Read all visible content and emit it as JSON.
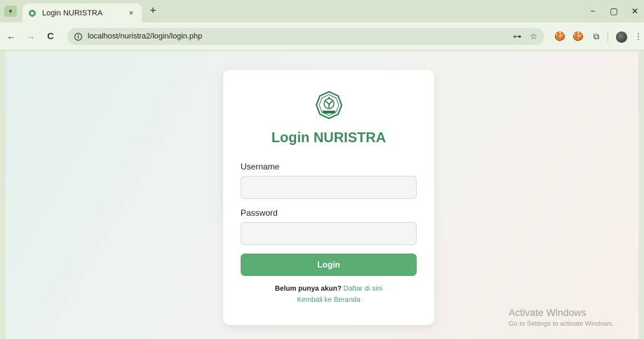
{
  "browser": {
    "tab": {
      "title": "Login NURISTRA",
      "close": "×"
    },
    "new_tab": "+",
    "window": {
      "minimize": "−",
      "restore": "▢",
      "close": "✕"
    },
    "nav": {
      "back": "←",
      "forward": "→",
      "reload": "C"
    },
    "address": {
      "info": "i",
      "url": "localhost/nuristra2/login/login.php"
    },
    "icons": {
      "key": "⊶",
      "star": "☆",
      "ext1": "🍪",
      "ext2": "🍪",
      "puzzle": "⧉",
      "menu": "⋮"
    }
  },
  "login": {
    "title": "Login NURISTRA",
    "username_label": "Username",
    "username_value": "",
    "password_label": "Password",
    "password_value": "",
    "submit": "Login",
    "signup_prompt": "Belum punya akun?",
    "signup_link": "Daftar di sini",
    "home_link": "Kembali ke Beranda"
  },
  "logo_text": "NURISTRA",
  "watermark": {
    "title": "Activate Windows",
    "subtitle": "Go to Settings to activate Windows."
  },
  "colors": {
    "brand_green": "#3f8a60",
    "button_green": "#59ad73",
    "link_green": "#4a9e6a"
  }
}
